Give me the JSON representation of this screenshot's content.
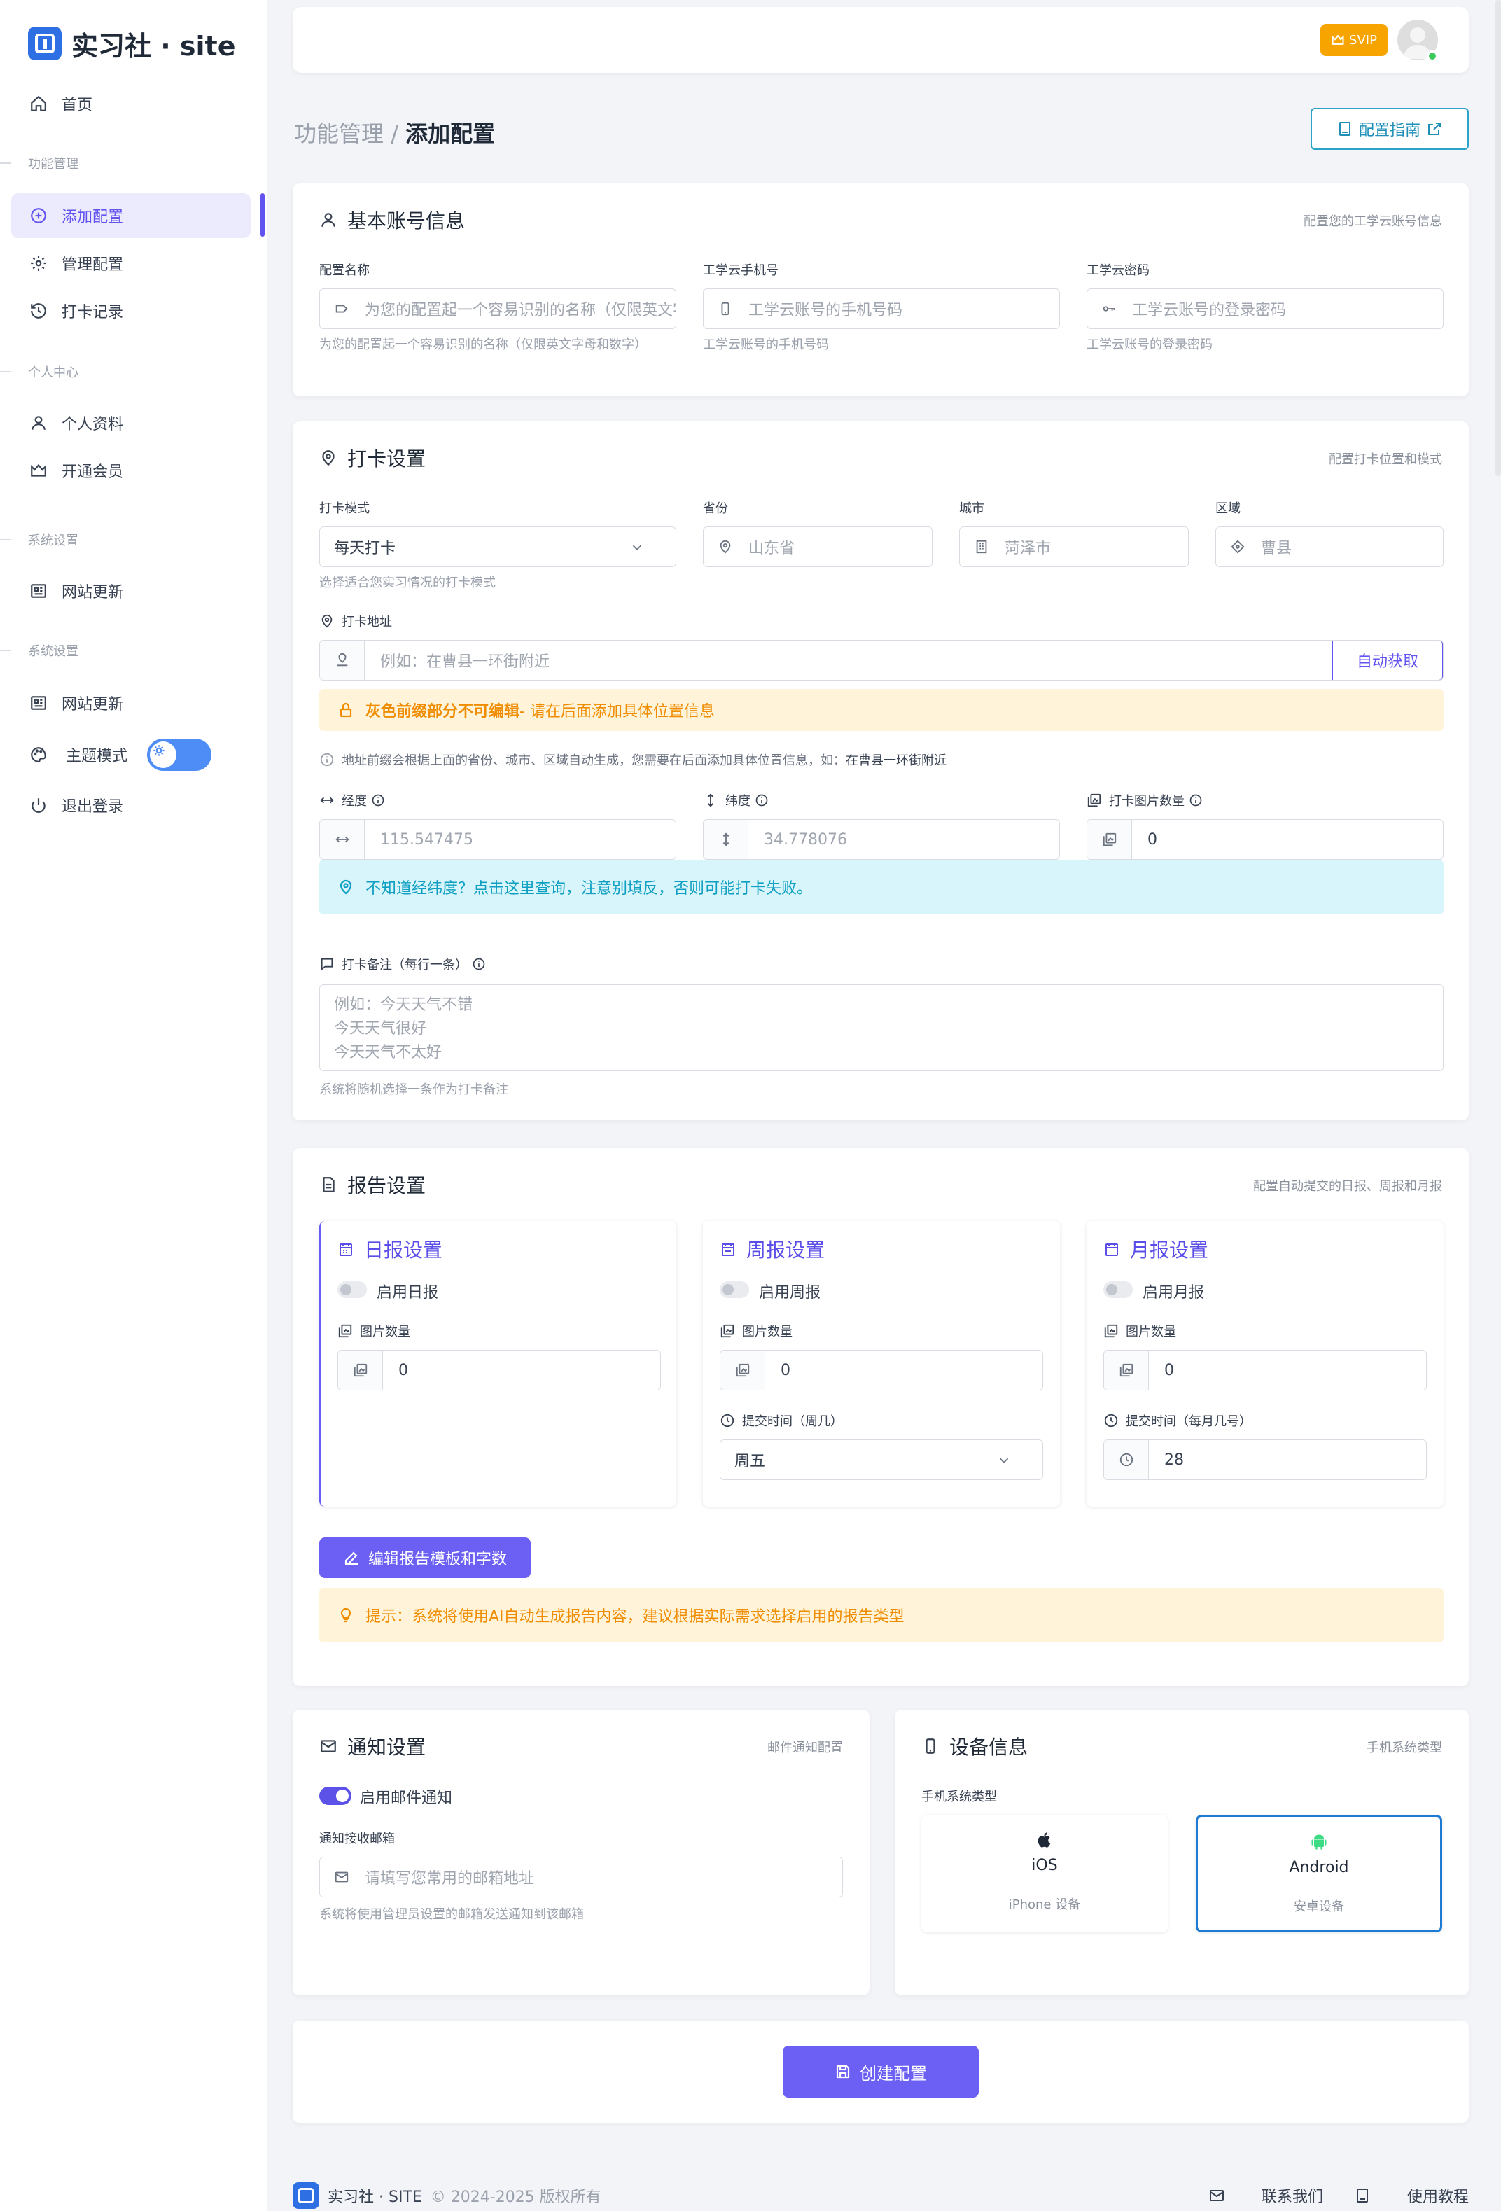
{
  "brand": {
    "name": "实习社 · site"
  },
  "sidebar": {
    "home": "首页",
    "sections": [
      "功能管理",
      "个人中心",
      "系统设置",
      "系统设置"
    ],
    "items": [
      {
        "label": "添加配置",
        "icon": "plus-circle-icon",
        "active": true
      },
      {
        "label": "管理配置",
        "icon": "gear-icon"
      },
      {
        "label": "打卡记录",
        "icon": "history-icon"
      },
      {
        "label": "个人资料",
        "icon": "user-icon"
      },
      {
        "label": "开通会员",
        "icon": "crown-icon"
      },
      {
        "label": "网站更新",
        "icon": "news-icon"
      },
      {
        "label": "网站更新",
        "icon": "news-icon"
      },
      {
        "label": "主题模式",
        "icon": "palette-icon"
      },
      {
        "label": "退出登录",
        "icon": "power-icon"
      }
    ]
  },
  "header": {
    "badge": "SVIP",
    "online_color": "#3cc85a"
  },
  "breadcrumb": {
    "parent": "功能管理",
    "separator": " / ",
    "current": "添加配置"
  },
  "guide_button": "配置指南",
  "account": {
    "title": "基本账号信息",
    "subtitle": "配置您的工学云账号信息",
    "name_label": "配置名称",
    "name_placeholder": "为您的配置起一个容易识别的名称（仅限英文字母和数字）",
    "name_hint": "为您的配置起一个容易识别的名称（仅限英文字母和数字）",
    "phone_label": "工学云手机号",
    "phone_placeholder": "工学云账号的手机号码",
    "phone_hint": "工学云账号的手机号码",
    "pwd_label": "工学云密码",
    "pwd_placeholder": "工学云账号的登录密码",
    "pwd_hint": "工学云账号的登录密码"
  },
  "checkin": {
    "title": "打卡设置",
    "subtitle": "配置打卡位置和模式",
    "mode_label": "打卡模式",
    "mode_value": "每天打卡",
    "mode_hint": "选择适合您实习情况的打卡模式",
    "province_label": "省份",
    "province_placeholder": "山东省",
    "city_label": "城市",
    "city_placeholder": "菏泽市",
    "district_label": "区域",
    "district_placeholder": "曹县",
    "address_label": "打卡地址",
    "address_placeholder": "例如：在曹县一环街附近",
    "auto_button": "自动获取",
    "warn_strong": "灰色前缀部分不可编辑",
    "warn_rest": " - 请在后面添加具体位置信息",
    "address_note": "地址前缀会根据上面的省份、城市、区域自动生成，您需要在后面添加具体位置信息，如：",
    "address_note_example": "在曹县一环街附近",
    "lng_label": "经度",
    "lng_placeholder": "115.547475",
    "lat_label": "纬度",
    "lat_placeholder": "34.778076",
    "img_label": "打卡图片数量",
    "img_value": "0",
    "lnglat_tip": "不知道经纬度？点击这里查询，注意别填反，否则可能打卡失败。",
    "remark_label": "打卡备注（每行一条）",
    "remark_placeholder": [
      "例如：今天天气不错",
      "今天天气很好",
      "今天天气不太好"
    ],
    "remark_hint": "系统将随机选择一条作为打卡备注"
  },
  "report": {
    "title": "报告设置",
    "subtitle": "配置自动提交的日报、周报和月报",
    "daily": {
      "title": "日报设置",
      "toggle": "启用日报",
      "img_label": "图片数量",
      "img_value": "0"
    },
    "weekly": {
      "title": "周报设置",
      "toggle": "启用周报",
      "img_label": "图片数量",
      "img_value": "0",
      "time_label": "提交时间（周几）",
      "time_value": "周五"
    },
    "monthly": {
      "title": "月报设置",
      "toggle": "启用月报",
      "img_label": "图片数量",
      "img_value": "0",
      "time_label": "提交时间（每月几号）",
      "time_value": "28"
    },
    "edit_button": "编辑报告模板和字数",
    "tip": "提示：系统将使用AI自动生成报告内容，建议根据实际需求选择启用的报告类型"
  },
  "notify": {
    "title": "通知设置",
    "subtitle": "邮件通知配置",
    "toggle": "启用邮件通知",
    "email_label": "通知接收邮箱",
    "email_placeholder": "请填写您常用的邮箱地址",
    "email_hint": "系统将使用管理员设置的邮箱发送通知到该邮箱"
  },
  "device": {
    "title": "设备信息",
    "subtitle": "手机系统类型",
    "type_label": "手机系统类型",
    "options": [
      {
        "name": "iOS",
        "sub": "iPhone 设备",
        "icon": "apple-icon",
        "selected": false
      },
      {
        "name": "Android",
        "sub": "安卓设备",
        "icon": "android-icon",
        "selected": true
      }
    ]
  },
  "create_button": "创建配置",
  "footer": {
    "brand": "实习社 · SITE",
    "copyright": "© 2024-2025 版权所有",
    "contact": "联系我们",
    "tutorial": "使用教程"
  },
  "colors": {
    "primary": "#6254f0",
    "brand": "#2f6fe4",
    "warn": "#f08c00",
    "info": "#0e9fc2",
    "svip": "#f7a400"
  }
}
